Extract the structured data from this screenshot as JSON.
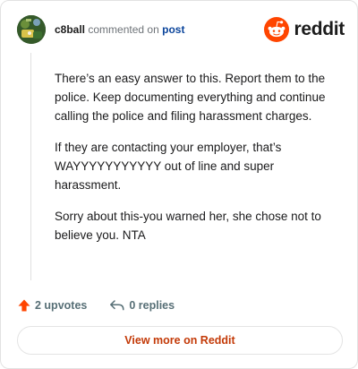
{
  "comment": {
    "author": "c8ball",
    "action_text": "commented on",
    "post_link_text": "post",
    "paragraphs": [
      "There’s an easy answer to this. Report them to the police. Keep documenting everything and continue calling the police and filing harassment charges.",
      "If they are contacting your employer, that’s WAYYYYYYYYYYY out of line and super harassment.",
      "Sorry about this-you warned her, she chose not to believe you. NTA"
    ],
    "upvotes_text": "2 upvotes",
    "replies_text": "0 replies"
  },
  "brand": {
    "name": "reddit",
    "accent_color": "#ff4500"
  },
  "cta": {
    "label": "View more on Reddit",
    "color": "#c33a08"
  },
  "icons": {
    "avatar": "avatar-image",
    "logo": "reddit-snoo-icon",
    "upvote": "upvote-arrow-icon",
    "reply": "reply-arrow-icon"
  }
}
